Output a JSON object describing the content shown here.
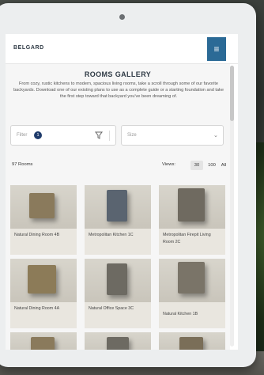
{
  "header": {
    "logo": "BELGARD",
    "menu_icon": "≡"
  },
  "page": {
    "title": "ROOMS GALLERY",
    "intro": "From cozy, rustic kitchens to modern, spacious living rooms, take a scroll through some of our favorite backyards. Download one of our existing plans to use as a complete guide or a starting foundation and take the first step toward that backyard you've been dreaming of."
  },
  "filters": {
    "filter_label": "Filter",
    "filter_count": "1",
    "size_placeholder": "Size"
  },
  "results": {
    "count_label": "97 Rooms",
    "views_label": "Views:",
    "view_options": [
      "30",
      "100",
      "All"
    ],
    "active_view": "30"
  },
  "rooms": [
    {
      "name": "Natural Dining Room 4B",
      "color": "#8a7a5c"
    },
    {
      "name": "Metropolitan Kitchen 1C",
      "color": "#5a6470"
    },
    {
      "name": "Metropolitan Firepit Living Room 2C",
      "color": "#6f6a60"
    },
    {
      "name": "Natural Dining Room 4A",
      "color": "#8c7b58"
    },
    {
      "name": "Natural Office Space 3C",
      "color": "#6d6a62"
    },
    {
      "name": "Natural Kitchen 1B",
      "color": "#7a7468"
    }
  ],
  "colors": {
    "accent": "#2b6a96",
    "title": "#2f3a45",
    "badge": "#1f3b6b"
  }
}
